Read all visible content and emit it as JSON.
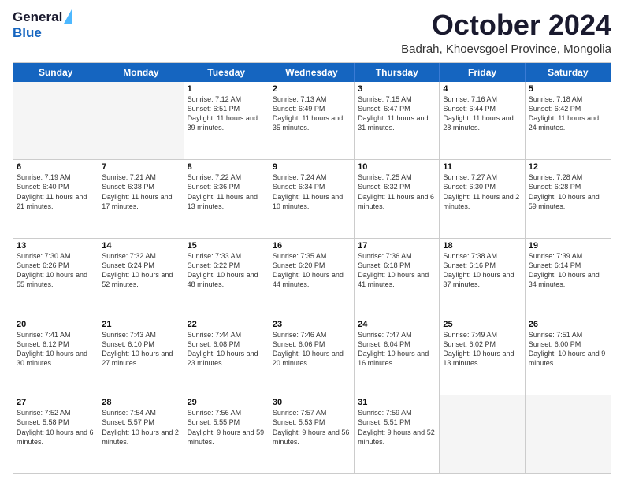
{
  "logo": {
    "general": "General",
    "blue": "Blue"
  },
  "title": "October 2024",
  "location": "Badrah, Khoevsgoel Province, Mongolia",
  "days": [
    "Sunday",
    "Monday",
    "Tuesday",
    "Wednesday",
    "Thursday",
    "Friday",
    "Saturday"
  ],
  "weeks": [
    [
      {
        "day": "",
        "content": ""
      },
      {
        "day": "",
        "content": ""
      },
      {
        "day": "1",
        "content": "Sunrise: 7:12 AM\nSunset: 6:51 PM\nDaylight: 11 hours and 39 minutes."
      },
      {
        "day": "2",
        "content": "Sunrise: 7:13 AM\nSunset: 6:49 PM\nDaylight: 11 hours and 35 minutes."
      },
      {
        "day": "3",
        "content": "Sunrise: 7:15 AM\nSunset: 6:47 PM\nDaylight: 11 hours and 31 minutes."
      },
      {
        "day": "4",
        "content": "Sunrise: 7:16 AM\nSunset: 6:44 PM\nDaylight: 11 hours and 28 minutes."
      },
      {
        "day": "5",
        "content": "Sunrise: 7:18 AM\nSunset: 6:42 PM\nDaylight: 11 hours and 24 minutes."
      }
    ],
    [
      {
        "day": "6",
        "content": "Sunrise: 7:19 AM\nSunset: 6:40 PM\nDaylight: 11 hours and 21 minutes."
      },
      {
        "day": "7",
        "content": "Sunrise: 7:21 AM\nSunset: 6:38 PM\nDaylight: 11 hours and 17 minutes."
      },
      {
        "day": "8",
        "content": "Sunrise: 7:22 AM\nSunset: 6:36 PM\nDaylight: 11 hours and 13 minutes."
      },
      {
        "day": "9",
        "content": "Sunrise: 7:24 AM\nSunset: 6:34 PM\nDaylight: 11 hours and 10 minutes."
      },
      {
        "day": "10",
        "content": "Sunrise: 7:25 AM\nSunset: 6:32 PM\nDaylight: 11 hours and 6 minutes."
      },
      {
        "day": "11",
        "content": "Sunrise: 7:27 AM\nSunset: 6:30 PM\nDaylight: 11 hours and 2 minutes."
      },
      {
        "day": "12",
        "content": "Sunrise: 7:28 AM\nSunset: 6:28 PM\nDaylight: 10 hours and 59 minutes."
      }
    ],
    [
      {
        "day": "13",
        "content": "Sunrise: 7:30 AM\nSunset: 6:26 PM\nDaylight: 10 hours and 55 minutes."
      },
      {
        "day": "14",
        "content": "Sunrise: 7:32 AM\nSunset: 6:24 PM\nDaylight: 10 hours and 52 minutes."
      },
      {
        "day": "15",
        "content": "Sunrise: 7:33 AM\nSunset: 6:22 PM\nDaylight: 10 hours and 48 minutes."
      },
      {
        "day": "16",
        "content": "Sunrise: 7:35 AM\nSunset: 6:20 PM\nDaylight: 10 hours and 44 minutes."
      },
      {
        "day": "17",
        "content": "Sunrise: 7:36 AM\nSunset: 6:18 PM\nDaylight: 10 hours and 41 minutes."
      },
      {
        "day": "18",
        "content": "Sunrise: 7:38 AM\nSunset: 6:16 PM\nDaylight: 10 hours and 37 minutes."
      },
      {
        "day": "19",
        "content": "Sunrise: 7:39 AM\nSunset: 6:14 PM\nDaylight: 10 hours and 34 minutes."
      }
    ],
    [
      {
        "day": "20",
        "content": "Sunrise: 7:41 AM\nSunset: 6:12 PM\nDaylight: 10 hours and 30 minutes."
      },
      {
        "day": "21",
        "content": "Sunrise: 7:43 AM\nSunset: 6:10 PM\nDaylight: 10 hours and 27 minutes."
      },
      {
        "day": "22",
        "content": "Sunrise: 7:44 AM\nSunset: 6:08 PM\nDaylight: 10 hours and 23 minutes."
      },
      {
        "day": "23",
        "content": "Sunrise: 7:46 AM\nSunset: 6:06 PM\nDaylight: 10 hours and 20 minutes."
      },
      {
        "day": "24",
        "content": "Sunrise: 7:47 AM\nSunset: 6:04 PM\nDaylight: 10 hours and 16 minutes."
      },
      {
        "day": "25",
        "content": "Sunrise: 7:49 AM\nSunset: 6:02 PM\nDaylight: 10 hours and 13 minutes."
      },
      {
        "day": "26",
        "content": "Sunrise: 7:51 AM\nSunset: 6:00 PM\nDaylight: 10 hours and 9 minutes."
      }
    ],
    [
      {
        "day": "27",
        "content": "Sunrise: 7:52 AM\nSunset: 5:58 PM\nDaylight: 10 hours and 6 minutes."
      },
      {
        "day": "28",
        "content": "Sunrise: 7:54 AM\nSunset: 5:57 PM\nDaylight: 10 hours and 2 minutes."
      },
      {
        "day": "29",
        "content": "Sunrise: 7:56 AM\nSunset: 5:55 PM\nDaylight: 9 hours and 59 minutes."
      },
      {
        "day": "30",
        "content": "Sunrise: 7:57 AM\nSunset: 5:53 PM\nDaylight: 9 hours and 56 minutes."
      },
      {
        "day": "31",
        "content": "Sunrise: 7:59 AM\nSunset: 5:51 PM\nDaylight: 9 hours and 52 minutes."
      },
      {
        "day": "",
        "content": ""
      },
      {
        "day": "",
        "content": ""
      }
    ]
  ]
}
